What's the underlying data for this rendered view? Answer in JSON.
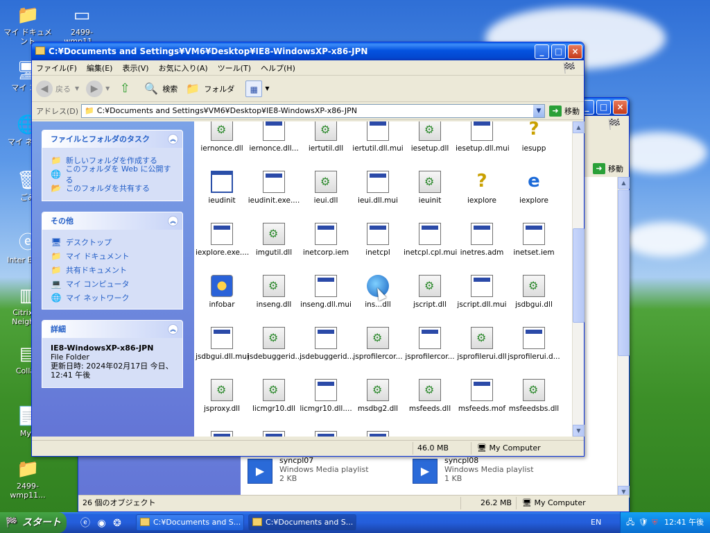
{
  "desktop": {
    "icons": [
      {
        "label": "マイ ドキュメント",
        "icon": "folder-icon"
      },
      {
        "label": "2499-wmp11...",
        "icon": "window-icon"
      },
      {
        "label": "マイ コン",
        "icon": "computer-icon"
      },
      {
        "label": "マイ ネット",
        "icon": "network-icon"
      },
      {
        "label": "ごみ",
        "icon": "recycle-bin-icon"
      },
      {
        "label": "Inter Explo",
        "icon": "ie-icon"
      },
      {
        "label": "Citrix Pr Neighbo",
        "icon": "citrix-icon"
      },
      {
        "label": "Collab",
        "icon": "collab-icon"
      },
      {
        "label": "MyF",
        "icon": "myfiles-icon"
      },
      {
        "label": "2499-wmp11...",
        "icon": "folder-icon"
      }
    ]
  },
  "background_window": {
    "go_label": "移動",
    "files": [
      {
        "name": "syncpl07",
        "type": "Windows Media playlist",
        "size": "2 KB"
      },
      {
        "name": "syncpl08",
        "type": "Windows Media playlist",
        "size": "1 KB"
      }
    ],
    "status": {
      "objects": "26 個のオブジェクト",
      "size": "26.2 MB",
      "location": "My Computer"
    }
  },
  "main_window": {
    "title": "C:¥Documents and Settings¥VM6¥Desktop¥IE8-WindowsXP-x86-JPN",
    "menu": [
      "ファイル(F)",
      "編集(E)",
      "表示(V)",
      "お気に入り(A)",
      "ツール(T)",
      "ヘルプ(H)"
    ],
    "toolbar": {
      "back": "戻る",
      "search": "検索",
      "folders": "フォルダ"
    },
    "address": {
      "label": "アドレス(D)",
      "value": "C:¥Documents and Settings¥VM6¥Desktop¥IE8-WindowsXP-x86-JPN",
      "go": "移動"
    },
    "tasks_panel": {
      "title": "ファイルとフォルダのタスク",
      "items": [
        "新しいフォルダを作成する",
        "このフォルダを Web に公開する",
        "このフォルダを共有する"
      ]
    },
    "other_panel": {
      "title": "その他",
      "items": [
        "デスクトップ",
        "マイ ドキュメント",
        "共有ドキュメント",
        "マイ コンピュータ",
        "マイ ネットワーク"
      ]
    },
    "details_panel": {
      "title": "詳細",
      "name": "IE8-WindowsXP-x86-JPN",
      "type": "File Folder",
      "modified": "更新日時: 2024年02月17日 今日、12:41 午後"
    },
    "files": [
      {
        "name": "iernonce.dll",
        "kind": "dll"
      },
      {
        "name": "iernonce.dll...",
        "kind": "mui"
      },
      {
        "name": "iertutil.dll",
        "kind": "dll"
      },
      {
        "name": "iertutil.dll.mui",
        "kind": "mui"
      },
      {
        "name": "iesetup.dll",
        "kind": "dll"
      },
      {
        "name": "iesetup.dll.mui",
        "kind": "mui"
      },
      {
        "name": "iesupp",
        "kind": "q"
      },
      {
        "name": "ieudinit",
        "kind": "exe"
      },
      {
        "name": "ieudinit.exe....",
        "kind": "mui"
      },
      {
        "name": "ieui.dll",
        "kind": "dll"
      },
      {
        "name": "ieui.dll.mui",
        "kind": "mui"
      },
      {
        "name": "ieuinit",
        "kind": "dll"
      },
      {
        "name": "iexplore",
        "kind": "q"
      },
      {
        "name": "iexplore",
        "kind": "ie"
      },
      {
        "name": "iexplore.exe....",
        "kind": "mui"
      },
      {
        "name": "imgutil.dll",
        "kind": "dll"
      },
      {
        "name": "inetcorp.iem",
        "kind": "mui"
      },
      {
        "name": "inetcpl",
        "kind": "mui"
      },
      {
        "name": "inetcpl.cpl.mui",
        "kind": "mui"
      },
      {
        "name": "inetres.adm",
        "kind": "mui"
      },
      {
        "name": "inetset.iem",
        "kind": "mui"
      },
      {
        "name": "infobar",
        "kind": "info"
      },
      {
        "name": "inseng.dll",
        "kind": "dll"
      },
      {
        "name": "inseng.dll.mui",
        "kind": "mui"
      },
      {
        "name": "ins...dll",
        "kind": "ball"
      },
      {
        "name": "jscript.dll",
        "kind": "dll"
      },
      {
        "name": "jscript.dll.mui",
        "kind": "mui"
      },
      {
        "name": "jsdbgui.dll",
        "kind": "dll"
      },
      {
        "name": "jsdbgui.dll.mui",
        "kind": "mui"
      },
      {
        "name": "jsdebuggerid...",
        "kind": "dll"
      },
      {
        "name": "jsdebuggerid...",
        "kind": "mui"
      },
      {
        "name": "jsprofilercor...",
        "kind": "dll"
      },
      {
        "name": "jsprofilercor...",
        "kind": "mui"
      },
      {
        "name": "jsprofilerui.dll",
        "kind": "dll"
      },
      {
        "name": "jsprofilerui.d...",
        "kind": "mui"
      },
      {
        "name": "jsproxy.dll",
        "kind": "dll"
      },
      {
        "name": "licmgr10.dll",
        "kind": "dll"
      },
      {
        "name": "licmgr10.dll....",
        "kind": "mui"
      },
      {
        "name": "msdbg2.dll",
        "kind": "dll"
      },
      {
        "name": "msfeeds.dll",
        "kind": "dll"
      },
      {
        "name": "msfeeds.mof",
        "kind": "mui"
      },
      {
        "name": "msfeedsbs.dll",
        "kind": "dll"
      }
    ],
    "status": {
      "size": "46.0 MB",
      "location": "My Computer"
    }
  },
  "taskbar": {
    "start": "スタート",
    "apps": [
      "C:¥Documents and S...",
      "C:¥Documents and S..."
    ],
    "lang": "EN",
    "clock": "12:41 午後"
  }
}
